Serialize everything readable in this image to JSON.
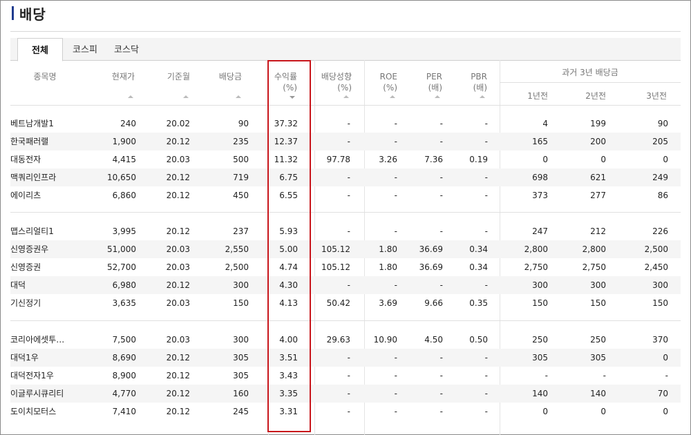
{
  "page_title": "배당",
  "tabs": [
    {
      "label": "전체",
      "active": true
    },
    {
      "label": "코스피",
      "active": false
    },
    {
      "label": "코스닥",
      "active": false
    }
  ],
  "headers": {
    "name": "종목명",
    "price": "현재가",
    "base_month": "기준월",
    "dividend": "배당금",
    "yield_line1": "수익률",
    "yield_line2": "(%)",
    "payout_line1": "배당성향",
    "payout_line2": "(%)",
    "roe_line1": "ROE",
    "roe_line2": "(%)",
    "per_line1": "PER",
    "per_line2": "(배)",
    "pbr_line1": "PBR",
    "pbr_line2": "(배)",
    "past_group": "과거 3년 배당금",
    "y1": "1년전",
    "y2": "2년전",
    "y3": "3년전"
  },
  "groups": [
    [
      {
        "name": "베트남개발1",
        "price": "240",
        "month": "20.02",
        "div": "90",
        "yield": "37.32",
        "payout": "-",
        "roe": "-",
        "per": "-",
        "pbr": "-",
        "y1": "4",
        "y2": "199",
        "y3": "90"
      },
      {
        "name": "한국패러랠",
        "price": "1,900",
        "month": "20.12",
        "div": "235",
        "yield": "12.37",
        "payout": "-",
        "roe": "-",
        "per": "-",
        "pbr": "-",
        "y1": "165",
        "y2": "200",
        "y3": "205"
      },
      {
        "name": "대동전자",
        "price": "4,415",
        "month": "20.03",
        "div": "500",
        "yield": "11.32",
        "payout": "97.78",
        "roe": "3.26",
        "per": "7.36",
        "pbr": "0.19",
        "y1": "0",
        "y2": "0",
        "y3": "0"
      },
      {
        "name": "맥쿼리인프라",
        "price": "10,650",
        "month": "20.12",
        "div": "719",
        "yield": "6.75",
        "payout": "-",
        "roe": "-",
        "per": "-",
        "pbr": "-",
        "y1": "698",
        "y2": "621",
        "y3": "249"
      },
      {
        "name": "에이리츠",
        "price": "6,860",
        "month": "20.12",
        "div": "450",
        "yield": "6.55",
        "payout": "-",
        "roe": "-",
        "per": "-",
        "pbr": "-",
        "y1": "373",
        "y2": "277",
        "y3": "86"
      }
    ],
    [
      {
        "name": "맵스리얼티1",
        "price": "3,995",
        "month": "20.12",
        "div": "237",
        "yield": "5.93",
        "payout": "-",
        "roe": "-",
        "per": "-",
        "pbr": "-",
        "y1": "247",
        "y2": "212",
        "y3": "226"
      },
      {
        "name": "신영증권우",
        "price": "51,000",
        "month": "20.03",
        "div": "2,550",
        "yield": "5.00",
        "payout": "105.12",
        "roe": "1.80",
        "per": "36.69",
        "pbr": "0.34",
        "y1": "2,800",
        "y2": "2,800",
        "y3": "2,500"
      },
      {
        "name": "신영증권",
        "price": "52,700",
        "month": "20.03",
        "div": "2,500",
        "yield": "4.74",
        "payout": "105.12",
        "roe": "1.80",
        "per": "36.69",
        "pbr": "0.34",
        "y1": "2,750",
        "y2": "2,750",
        "y3": "2,450"
      },
      {
        "name": "대덕",
        "price": "6,980",
        "month": "20.12",
        "div": "300",
        "yield": "4.30",
        "payout": "-",
        "roe": "-",
        "per": "-",
        "pbr": "-",
        "y1": "300",
        "y2": "300",
        "y3": "300"
      },
      {
        "name": "기신정기",
        "price": "3,635",
        "month": "20.03",
        "div": "150",
        "yield": "4.13",
        "payout": "50.42",
        "roe": "3.69",
        "per": "9.66",
        "pbr": "0.35",
        "y1": "150",
        "y2": "150",
        "y3": "150"
      }
    ],
    [
      {
        "name": "코리아에셋투…",
        "price": "7,500",
        "month": "20.03",
        "div": "300",
        "yield": "4.00",
        "payout": "29.63",
        "roe": "10.90",
        "per": "4.50",
        "pbr": "0.50",
        "y1": "250",
        "y2": "250",
        "y3": "370"
      },
      {
        "name": "대덕1우",
        "price": "8,690",
        "month": "20.12",
        "div": "305",
        "yield": "3.51",
        "payout": "-",
        "roe": "-",
        "per": "-",
        "pbr": "-",
        "y1": "305",
        "y2": "305",
        "y3": "0"
      },
      {
        "name": "대덕전자1우",
        "price": "8,900",
        "month": "20.12",
        "div": "305",
        "yield": "3.43",
        "payout": "-",
        "roe": "-",
        "per": "-",
        "pbr": "-",
        "y1": "-",
        "y2": "-",
        "y3": "-"
      },
      {
        "name": "이글루시큐리티",
        "price": "4,770",
        "month": "20.12",
        "div": "160",
        "yield": "3.35",
        "payout": "-",
        "roe": "-",
        "per": "-",
        "pbr": "-",
        "y1": "140",
        "y2": "140",
        "y3": "70"
      },
      {
        "name": "도이치모터스",
        "price": "7,410",
        "month": "20.12",
        "div": "245",
        "yield": "3.31",
        "payout": "-",
        "roe": "-",
        "per": "-",
        "pbr": "-",
        "y1": "0",
        "y2": "0",
        "y3": "0"
      }
    ]
  ],
  "colors": {
    "accent_bar": "#1f3b8f",
    "highlight_border": "#c8151b"
  }
}
